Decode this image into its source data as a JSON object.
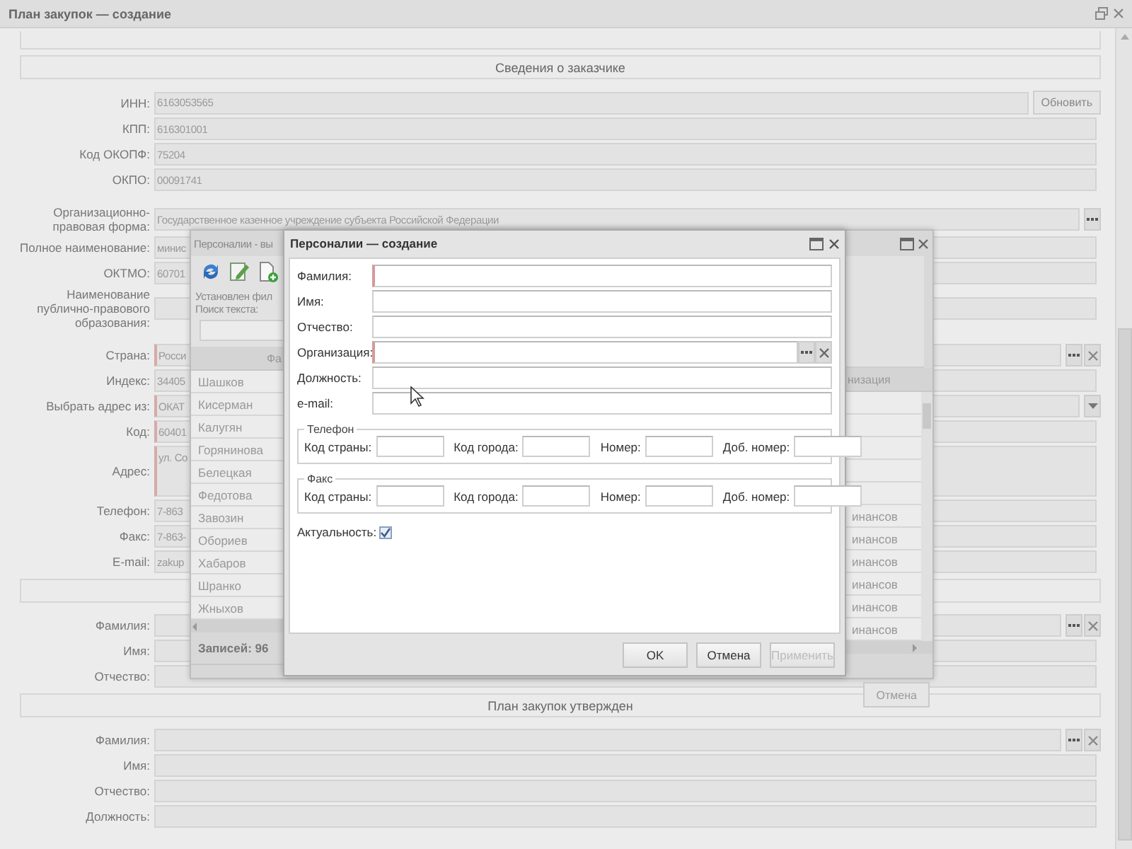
{
  "window": {
    "title": "План закупок — создание"
  },
  "form": [
    {
      "kind": "section",
      "label": "Сведения о заказчике"
    },
    {
      "kind": "field",
      "label": "ИНН:",
      "value": "6163053565",
      "required": false,
      "action": "Обновить"
    },
    {
      "kind": "field",
      "label": "КПП:",
      "value": "616301001",
      "required": false
    },
    {
      "kind": "field",
      "label": "Код ОКОПФ:",
      "value": "75204",
      "required": false
    },
    {
      "kind": "field",
      "label": "ОКПО:",
      "value": "00091741",
      "required": false
    },
    {
      "kind": "field",
      "label": "Организационно-правовая форма:",
      "value": "Государственное казенное учреждение субъекта Российской Федерации",
      "required": false,
      "gap_before": true,
      "lookup": true
    },
    {
      "kind": "field",
      "label": "Полное наименование:",
      "value": "минис",
      "required": false
    },
    {
      "kind": "field",
      "label": "ОКТМО:",
      "value": "60701",
      "required": false
    },
    {
      "kind": "field",
      "label": "Наименование публично-правового образования:",
      "required": false
    },
    {
      "kind": "field",
      "label": "Страна:",
      "value": "Росси",
      "required": true,
      "gap_before": true,
      "lookup": true,
      "clearable": true
    },
    {
      "kind": "field",
      "label": "Индекс:",
      "value": "34405",
      "required": false
    },
    {
      "kind": "field",
      "label": "Выбрать адрес из:",
      "value": "ОКАТ",
      "required": true,
      "dropdown": true
    },
    {
      "kind": "field",
      "label": "Код:",
      "value": "60401",
      "required": true
    },
    {
      "kind": "textarea",
      "label": "Адрес:",
      "value": "ул. Со",
      "required": true
    },
    {
      "kind": "field",
      "label": "Телефон:",
      "value": "7-863",
      "required": false
    },
    {
      "kind": "field",
      "label": "Факс:",
      "value": "7-863-",
      "required": false
    },
    {
      "kind": "field",
      "label": "E-mail:",
      "value": "zakup",
      "required": false
    },
    {
      "kind": "section"
    },
    {
      "kind": "field",
      "label": "Фамилия:",
      "required": false,
      "lookup": true,
      "clearable": true
    },
    {
      "kind": "field",
      "label": "Имя:",
      "required": false
    },
    {
      "kind": "field",
      "label": "Отчество:",
      "required": false
    },
    {
      "kind": "section",
      "label": "План закупок утвержден"
    },
    {
      "kind": "field",
      "label": "Фамилия:",
      "required": false,
      "lookup": true,
      "clearable": true
    },
    {
      "kind": "field",
      "label": "Имя:",
      "required": false
    },
    {
      "kind": "field",
      "label": "Отчество:",
      "required": false
    },
    {
      "kind": "field",
      "label": "Должность:",
      "required": false
    }
  ],
  "list_dialog": {
    "title": "Персоналии - вы",
    "filter_text": "Установлен фил",
    "search_label": "Поиск текста:",
    "columns": [
      "Фа",
      "низация"
    ],
    "rows": [
      {
        "name": "Шашков"
      },
      {
        "name": "Кисерман"
      },
      {
        "name": "Калугян"
      },
      {
        "name": "Горянинова"
      },
      {
        "name": "Белецкая"
      },
      {
        "name": "Федотова",
        "column_2": "инансов"
      },
      {
        "name": "Завозин",
        "column_2": "инансов"
      },
      {
        "name": "Обориев",
        "column_2": "инансов"
      },
      {
        "name": "Хабаров",
        "column_2": "инансов"
      },
      {
        "name": "Шранко",
        "column_2": "инансов"
      },
      {
        "name": "Жныхов",
        "column_2": "инансов"
      }
    ],
    "count": "Записей: 96",
    "buttons": [
      {
        "label": "Отмена"
      }
    ]
  },
  "dialog": {
    "title": "Персоналии — создание",
    "fields": [
      {
        "label": "Фамилия:",
        "required": true,
        "lookup": false
      },
      {
        "label": "Имя:",
        "required": false,
        "lookup": false
      },
      {
        "label": "Отчество:",
        "required": false,
        "lookup": false
      },
      {
        "label": "Организация:",
        "required": true,
        "lookup": true
      },
      {
        "label": "Должность:",
        "required": false,
        "lookup": false
      },
      {
        "label": "e-mail:",
        "required": false,
        "lookup": false
      }
    ],
    "groups": [
      {
        "legend": "Телефон",
        "fields": [
          "Код страны:",
          "Код города:",
          "Номер:",
          "Доб. номер:"
        ]
      },
      {
        "legend": "Факс",
        "fields": [
          "Код страны:",
          "Код города:",
          "Номер:",
          "Доб. номер:"
        ]
      }
    ],
    "checkbox": {
      "label": "Актуальность:",
      "checked": true
    },
    "buttons": [
      {
        "label": "OK",
        "disabled": false
      },
      {
        "label": "Отмена",
        "disabled": false
      },
      {
        "label": "Применить",
        "disabled": true
      }
    ]
  }
}
